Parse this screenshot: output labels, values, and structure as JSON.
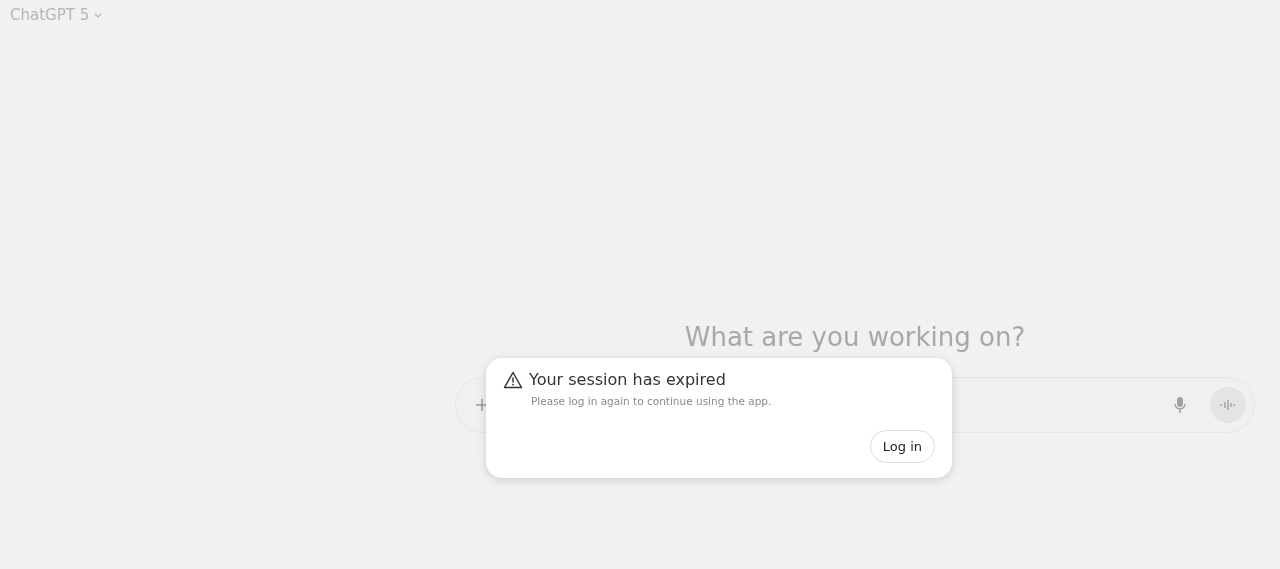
{
  "header": {
    "model_label": "ChatGPT 5"
  },
  "main": {
    "heading": "What are you working on?"
  },
  "dialog": {
    "title": "Your session has expired",
    "message": "Please log in again to continue using the app.",
    "button": "Log in"
  }
}
